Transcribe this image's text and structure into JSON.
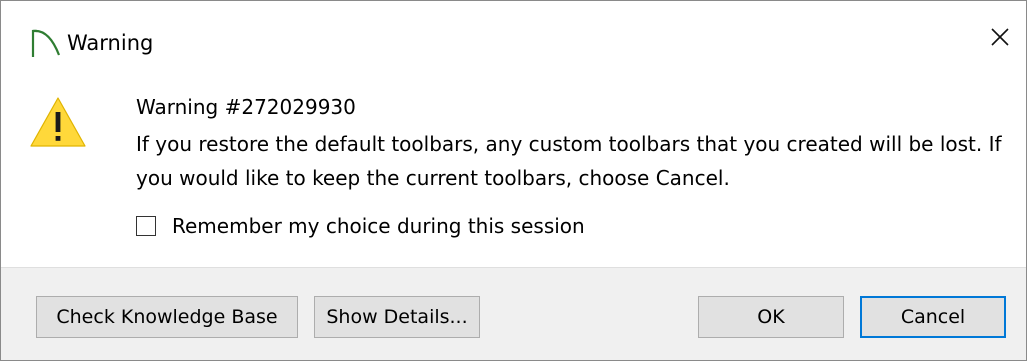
{
  "window": {
    "title": "Warning",
    "icon": "app-arc-icon",
    "close_icon": "close-icon"
  },
  "message": {
    "icon": "warning-icon",
    "heading": "Warning #272029930",
    "body": "If you restore the default toolbars, any custom toolbars that you created will be lost. If you would like to keep the current toolbars, choose Cancel."
  },
  "remember": {
    "label": "Remember my choice during this session",
    "checked": false
  },
  "buttons": {
    "knowledge_base": "Check Knowledge Base",
    "show_details": "Show Details...",
    "ok": "OK",
    "cancel": "Cancel"
  },
  "colors": {
    "warning_fill": "#ffd83a",
    "focus_border": "#0078d7",
    "footer_bg": "#f0f0f0",
    "button_bg": "#e1e1e1"
  }
}
